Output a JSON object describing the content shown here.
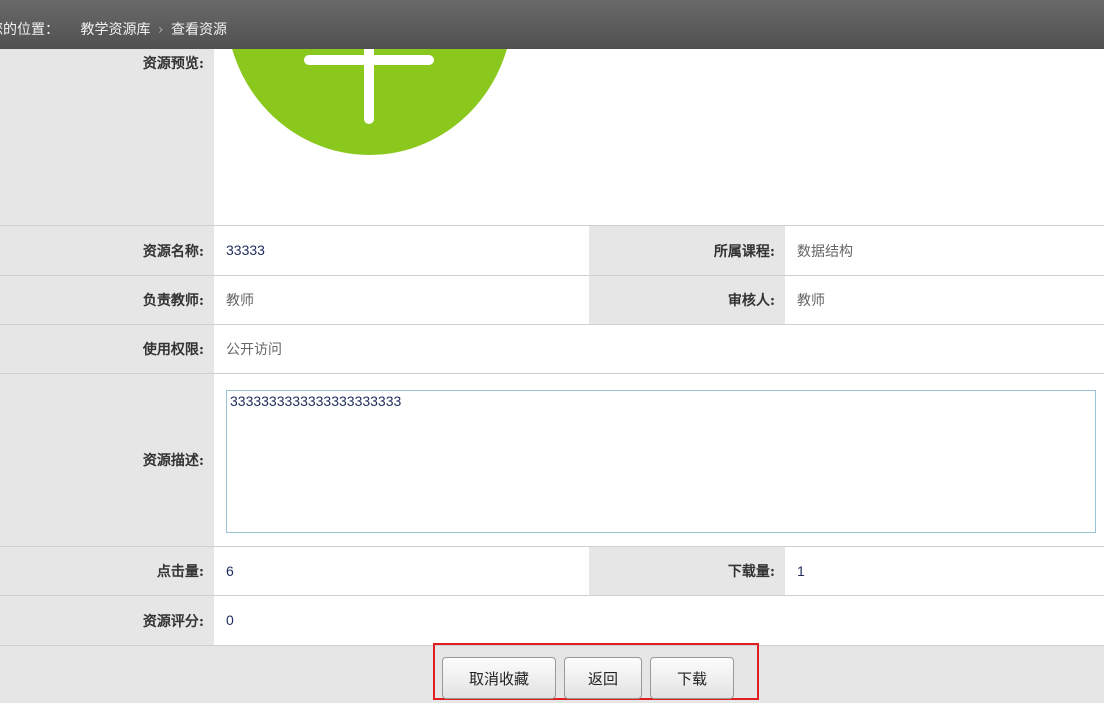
{
  "breadcrumb": {
    "prefix": "您的位置：",
    "items": [
      "教学资源库",
      "查看资源"
    ],
    "separator": "›"
  },
  "preview": {
    "label": "资源预览:"
  },
  "fields": {
    "name": {
      "label": "资源名称:",
      "value": "33333"
    },
    "course": {
      "label": "所属课程:",
      "value": "数据结构"
    },
    "teacher": {
      "label": "负责教师:",
      "value": "教师"
    },
    "reviewer": {
      "label": "审核人:",
      "value": "教师"
    },
    "permission": {
      "label": "使用权限:",
      "value": "公开访问"
    },
    "description": {
      "label": "资源描述:",
      "value": "3333333333333333333333"
    },
    "clicks": {
      "label": "点击量:",
      "value": "6"
    },
    "downloads": {
      "label": "下载量:",
      "value": "1"
    },
    "rating": {
      "label": "资源评分:",
      "value": "0"
    }
  },
  "actions": {
    "unfavorite": "取消收藏",
    "back": "返回",
    "download": "下载"
  },
  "colors": {
    "header_bg": "#5a5a5a",
    "label_bg": "#e6e6e6",
    "preview_green": "#8bc81d",
    "highlight_border": "#e02020"
  }
}
